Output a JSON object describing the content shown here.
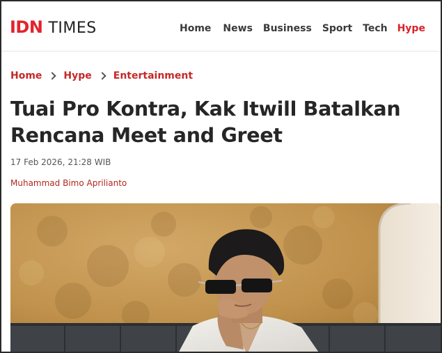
{
  "header": {
    "logo_primary": "IDN",
    "logo_secondary": "TIMES",
    "nav": [
      "Home",
      "News",
      "Business",
      "Sport",
      "Tech",
      "Hype"
    ],
    "active_nav": "Hype"
  },
  "breadcrumb": [
    "Home",
    "Hype",
    "Entertainment"
  ],
  "article": {
    "title": "Tuai Pro Kontra, Kak Itwill Batalkan Rencana Meet and Greet",
    "date": "17 Feb 2026, 21:28 WIB",
    "author": "Muhammad Bimo Aprilianto"
  },
  "hero_image": {
    "subject": "man-with-sunglasses-photo"
  },
  "colors": {
    "brand_red": "#e3232c",
    "breadcrumb_red": "#c62828",
    "title_text": "#262626"
  }
}
